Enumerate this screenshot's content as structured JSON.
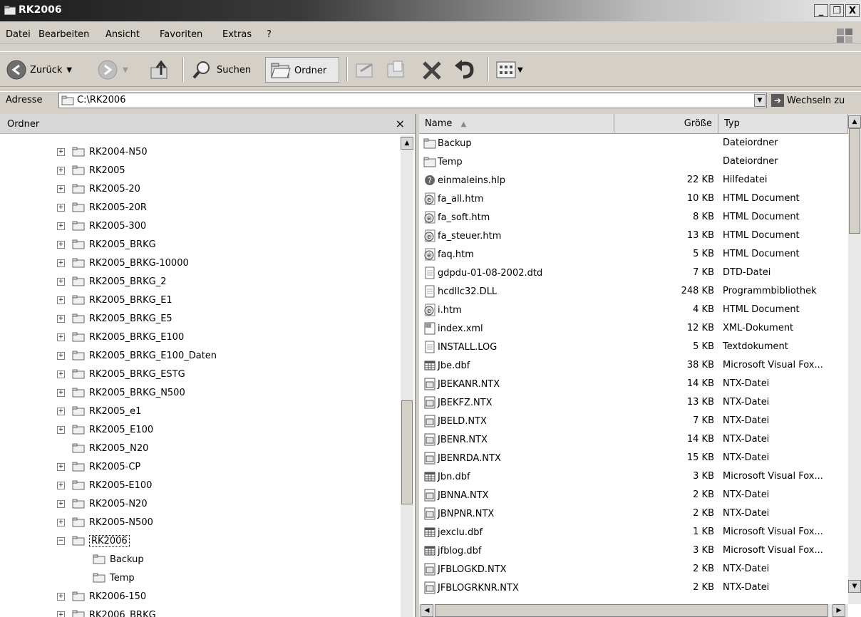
{
  "window": {
    "title": "RK2006",
    "controls": [
      "_",
      "Ő",
      "X"
    ]
  },
  "menu": [
    {
      "label": "Datei",
      "key": "D"
    },
    {
      "label": "Bearbeiten",
      "key": "B"
    },
    {
      "label": "Ansicht",
      "key": "A"
    },
    {
      "label": "Favoriten",
      "key": "F"
    },
    {
      "label": "Extras",
      "key": "t"
    },
    {
      "label": "?",
      "key": "?"
    }
  ],
  "toolbar": {
    "back_label": "Zurück",
    "search_label": "Suchen",
    "folders_label": "Ordner"
  },
  "address": {
    "label": "Adresse",
    "value": "C:\\RK2006",
    "go_label": "Wechseln zu"
  },
  "folder_pane": {
    "header": "Ordner",
    "close": "×",
    "tree": [
      {
        "label": "RK2004-N50",
        "exp": "+"
      },
      {
        "label": "RK2005",
        "exp": "+"
      },
      {
        "label": "RK2005-20",
        "exp": "+"
      },
      {
        "label": "RK2005-20R",
        "exp": "+"
      },
      {
        "label": "RK2005-300",
        "exp": "+"
      },
      {
        "label": "RK2005_BRKG",
        "exp": "+"
      },
      {
        "label": "RK2005_BRKG-10000",
        "exp": "+"
      },
      {
        "label": "RK2005_BRKG_2",
        "exp": "+"
      },
      {
        "label": "RK2005_BRKG_E1",
        "exp": "+"
      },
      {
        "label": "RK2005_BRKG_E5",
        "exp": "+"
      },
      {
        "label": "RK2005_BRKG_E100",
        "exp": "+"
      },
      {
        "label": "RK2005_BRKG_E100_Daten",
        "exp": "+"
      },
      {
        "label": "RK2005_BRKG_ESTG",
        "exp": "+"
      },
      {
        "label": "RK2005_BRKG_N500",
        "exp": "+"
      },
      {
        "label": "RK2005_e1",
        "exp": "+"
      },
      {
        "label": "RK2005_E100",
        "exp": "+"
      },
      {
        "label": "RK2005_N20",
        "exp": ""
      },
      {
        "label": "RK2005-CP",
        "exp": "+"
      },
      {
        "label": "RK2005-E100",
        "exp": "+"
      },
      {
        "label": "RK2005-N20",
        "exp": "+"
      },
      {
        "label": "RK2005-N500",
        "exp": "+"
      },
      {
        "label": "RK2006",
        "exp": "−",
        "selected": true
      },
      {
        "label": "Backup",
        "exp": "",
        "child": true
      },
      {
        "label": "Temp",
        "exp": "",
        "child": true
      },
      {
        "label": "RK2006-150",
        "exp": "+"
      },
      {
        "label": "RK2006_BRKG",
        "exp": "+"
      }
    ]
  },
  "file_pane": {
    "columns": {
      "name": "Name",
      "size": "Größe",
      "type": "Typ"
    },
    "files": [
      {
        "name": "Backup",
        "size": "",
        "type": "Dateiordner",
        "icon": "folder-icon"
      },
      {
        "name": "Temp",
        "size": "",
        "type": "Dateiordner",
        "icon": "folder-icon"
      },
      {
        "name": "einmaleins.hlp",
        "size": "22 KB",
        "type": "Hilfedatei",
        "icon": "help-file-icon"
      },
      {
        "name": "fa_all.htm",
        "size": "10 KB",
        "type": "HTML Document",
        "icon": "html-file-icon"
      },
      {
        "name": "fa_soft.htm",
        "size": "8 KB",
        "type": "HTML Document",
        "icon": "html-file-icon"
      },
      {
        "name": "fa_steuer.htm",
        "size": "13 KB",
        "type": "HTML Document",
        "icon": "html-file-icon"
      },
      {
        "name": "faq.htm",
        "size": "5 KB",
        "type": "HTML Document",
        "icon": "html-file-icon"
      },
      {
        "name": "gdpdu-01-08-2002.dtd",
        "size": "7 KB",
        "type": "DTD-Datei",
        "icon": "dtd-file-icon"
      },
      {
        "name": "hcdllc32.DLL",
        "size": "248 KB",
        "type": "Programmbibliothek",
        "icon": "dll-file-icon"
      },
      {
        "name": "i.htm",
        "size": "4 KB",
        "type": "HTML Document",
        "icon": "html-file-icon"
      },
      {
        "name": "index.xml",
        "size": "12 KB",
        "type": "XML-Dokument",
        "icon": "xml-file-icon"
      },
      {
        "name": "INSTALL.LOG",
        "size": "5 KB",
        "type": "Textdokument",
        "icon": "text-file-icon"
      },
      {
        "name": "Jbe.dbf",
        "size": "38 KB",
        "type": "Microsoft Visual Fox...",
        "icon": "dbf-file-icon"
      },
      {
        "name": "JBEKANR.NTX",
        "size": "14 KB",
        "type": "NTX-Datei",
        "icon": "ntx-file-icon"
      },
      {
        "name": "JBEKFZ.NTX",
        "size": "13 KB",
        "type": "NTX-Datei",
        "icon": "ntx-file-icon"
      },
      {
        "name": "JBELD.NTX",
        "size": "7 KB",
        "type": "NTX-Datei",
        "icon": "ntx-file-icon"
      },
      {
        "name": "JBENR.NTX",
        "size": "14 KB",
        "type": "NTX-Datei",
        "icon": "ntx-file-icon"
      },
      {
        "name": "JBENRDA.NTX",
        "size": "15 KB",
        "type": "NTX-Datei",
        "icon": "ntx-file-icon"
      },
      {
        "name": "Jbn.dbf",
        "size": "3 KB",
        "type": "Microsoft Visual Fox...",
        "icon": "dbf-file-icon"
      },
      {
        "name": "JBNNA.NTX",
        "size": "2 KB",
        "type": "NTX-Datei",
        "icon": "ntx-file-icon"
      },
      {
        "name": "JBNPNR.NTX",
        "size": "2 KB",
        "type": "NTX-Datei",
        "icon": "ntx-file-icon"
      },
      {
        "name": "jexclu.dbf",
        "size": "1 KB",
        "type": "Microsoft Visual Fox...",
        "icon": "dbf-file-icon"
      },
      {
        "name": "jfblog.dbf",
        "size": "3 KB",
        "type": "Microsoft Visual Fox...",
        "icon": "dbf-file-icon"
      },
      {
        "name": "JFBLOGKD.NTX",
        "size": "2 KB",
        "type": "NTX-Datei",
        "icon": "ntx-file-icon"
      },
      {
        "name": "JFBLOGRKNR.NTX",
        "size": "2 KB",
        "type": "NTX-Datei",
        "icon": "ntx-file-icon"
      }
    ]
  }
}
